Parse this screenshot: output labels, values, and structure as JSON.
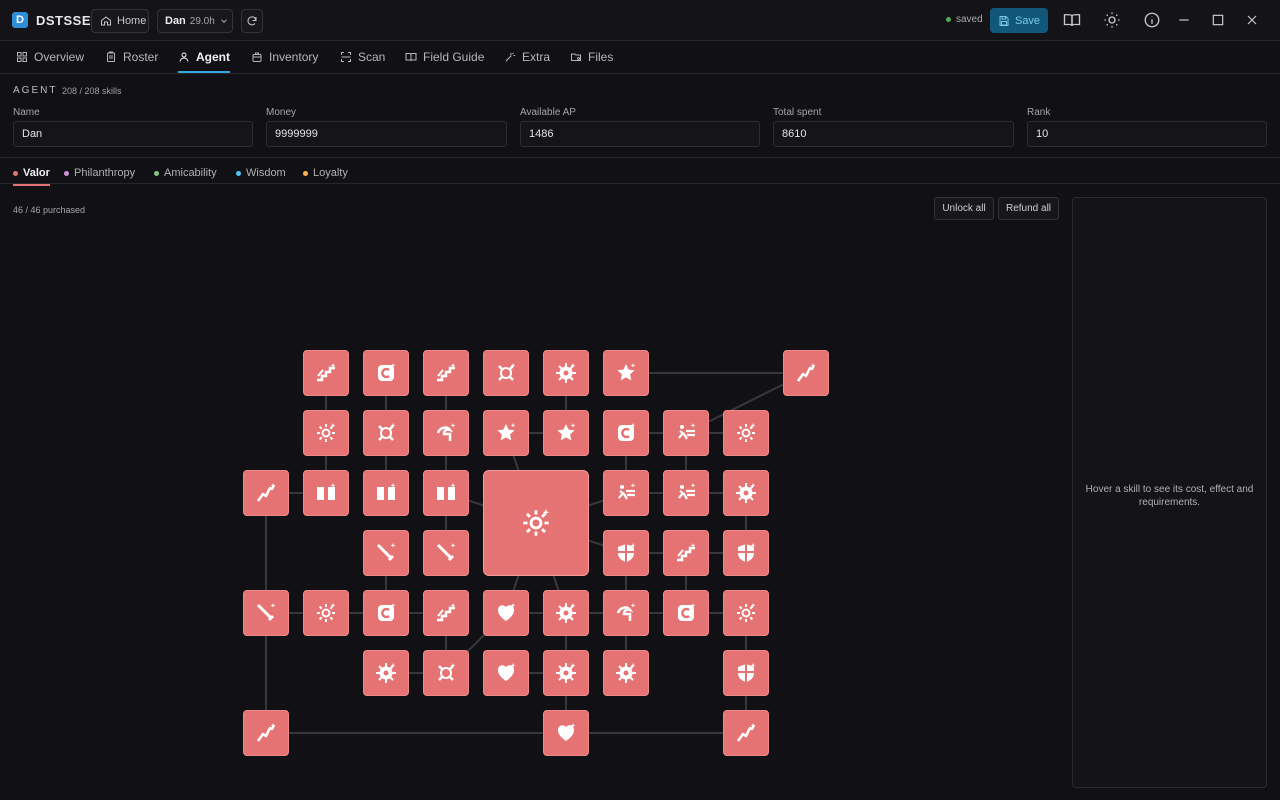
{
  "app": {
    "logo_letter": "D",
    "name": "DSTSSE"
  },
  "titlebar": {
    "home_label": "Home",
    "save_name": "Dan",
    "save_time": "29.0h",
    "status_text": "saved",
    "status_color": "#4caf50",
    "save_label": "Save"
  },
  "nav": {
    "tabs": [
      {
        "label": "Overview",
        "icon": "grid-icon"
      },
      {
        "label": "Roster",
        "icon": "clipboard-icon"
      },
      {
        "label": "Agent",
        "icon": "user-icon"
      },
      {
        "label": "Inventory",
        "icon": "bag-icon"
      },
      {
        "label": "Scan",
        "icon": "scan-icon"
      },
      {
        "label": "Field Guide",
        "icon": "book-icon"
      },
      {
        "label": "Extra",
        "icon": "wand-icon"
      },
      {
        "label": "Files",
        "icon": "folder-icon"
      }
    ],
    "active": "Agent"
  },
  "agent": {
    "title": "AGENT",
    "skills_count": "208 / 208 skills",
    "fields": [
      {
        "label": "Name",
        "value": "Dan"
      },
      {
        "label": "Money",
        "value": "9999999"
      },
      {
        "label": "Available AP",
        "value": "1486"
      },
      {
        "label": "Total spent",
        "value": "8610"
      },
      {
        "label": "Rank",
        "value": "10"
      }
    ]
  },
  "categories": [
    {
      "label": "Valor",
      "color": "#e57373"
    },
    {
      "label": "Philanthropy",
      "color": "#ce93d8"
    },
    {
      "label": "Amicability",
      "color": "#81c784"
    },
    {
      "label": "Wisdom",
      "color": "#4fc3f7"
    },
    {
      "label": "Loyalty",
      "color": "#ffb74d"
    }
  ],
  "active_category": "Valor",
  "tree": {
    "purchased_text": "46 / 46 purchased",
    "unlock_all_label": "Unlock all",
    "refund_all_label": "Refund all",
    "node_color": "#e57373"
  },
  "info": {
    "hint": "Hover a skill to see its cost, effect and requirements."
  }
}
